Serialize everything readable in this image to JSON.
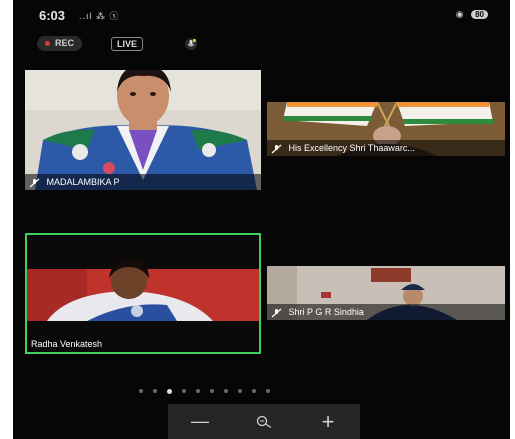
{
  "status": {
    "time": "6:03",
    "signal_text": "..ıl ⁂ ⓢ",
    "battery": "80"
  },
  "toolbar": {
    "rec_label": "REC",
    "live_label": "LIVE"
  },
  "tiles": [
    {
      "name": "MADALAMBIKA P",
      "muted": true,
      "active": false
    },
    {
      "name": "His Excellency Shri Thaawarc...",
      "muted": true,
      "active": false
    },
    {
      "name": "Radha Venkatesh",
      "muted": false,
      "active": true
    },
    {
      "name": "Shri  P G R Sindhia",
      "muted": true,
      "active": false
    }
  ],
  "pagination": {
    "count": 10,
    "active_index": 2
  },
  "zoom": {
    "minus": "—",
    "plus": "+"
  },
  "colors": {
    "active_speaker": "#3fcf5e",
    "rec_dot": "#e53935",
    "background": "#060606"
  }
}
